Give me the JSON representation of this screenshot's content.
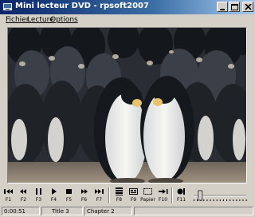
{
  "window": {
    "title": "Mini lecteur DVD - rpsoft2007",
    "icon": "dvd-app-icon"
  },
  "menu": {
    "items": [
      "Fichier",
      "Lecture",
      "Options"
    ]
  },
  "video": {
    "scene": "emperor penguins colony"
  },
  "toolbar": {
    "buttons": [
      {
        "icon": "skip-to-start-icon",
        "label": "F1"
      },
      {
        "icon": "rewind-icon",
        "label": "F2"
      },
      {
        "icon": "pause-icon",
        "label": "F3"
      },
      {
        "icon": "play-icon",
        "label": "F4"
      },
      {
        "icon": "stop-icon",
        "label": "F5"
      },
      {
        "icon": "fast-forward-icon",
        "label": "F6"
      },
      {
        "icon": "skip-to-end-icon",
        "label": "F7"
      },
      {
        "icon": "menu-list-icon",
        "label": "F8"
      },
      {
        "icon": "chapters-icon",
        "label": "F9"
      },
      {
        "icon": "capture-icon",
        "label": "Papier"
      },
      {
        "icon": "next-chapter-icon",
        "label": "F10"
      },
      {
        "icon": "subtitle-icon",
        "label": "F11"
      }
    ],
    "volume_level": 0.12
  },
  "status": {
    "time": "0:00:51",
    "title": "Title 3",
    "chapter": "Chapter 2"
  }
}
